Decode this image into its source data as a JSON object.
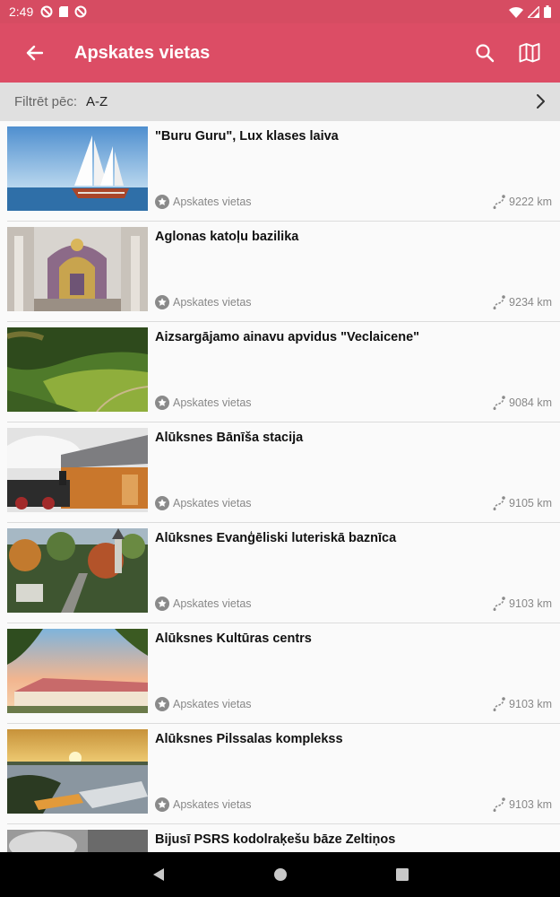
{
  "status": {
    "time": "2:49"
  },
  "app_bar": {
    "title": "Apskates vietas"
  },
  "filter": {
    "label": "Filtrēt pēc:",
    "value": "A-Z"
  },
  "items": [
    {
      "title": "\"Buru Guru\", Lux klases laiva",
      "category": "Apskates vietas",
      "distance": "9222 km"
    },
    {
      "title": "Aglonas katoļu bazilika",
      "category": "Apskates vietas",
      "distance": "9234 km"
    },
    {
      "title": "Aizsargājamo ainavu apvidus \"Veclaicene\"",
      "category": "Apskates vietas",
      "distance": "9084 km"
    },
    {
      "title": "Alūksnes Bānīša stacija",
      "category": "Apskates vietas",
      "distance": "9105 km"
    },
    {
      "title": "Alūksnes Evanģēliski luteriskā baznīca",
      "category": "Apskates vietas",
      "distance": "9103 km"
    },
    {
      "title": "Alūksnes Kultūras centrs",
      "category": "Apskates vietas",
      "distance": "9103 km"
    },
    {
      "title": "Alūksnes Pilssalas komplekss",
      "category": "Apskates vietas",
      "distance": "9103 km"
    },
    {
      "title": "Bijusī PSRS  kodolraķešu bāze Zeltiņos",
      "category": "",
      "distance": ""
    }
  ],
  "colors": {
    "app_bar": "#dc4d65",
    "status_bar": "#d64c62",
    "filter_bar": "#e0e0e0"
  },
  "icons": {
    "back": "arrow-left-icon",
    "search": "search-icon",
    "map": "map-icon",
    "category": "star-badge-icon",
    "distance": "route-icon"
  }
}
